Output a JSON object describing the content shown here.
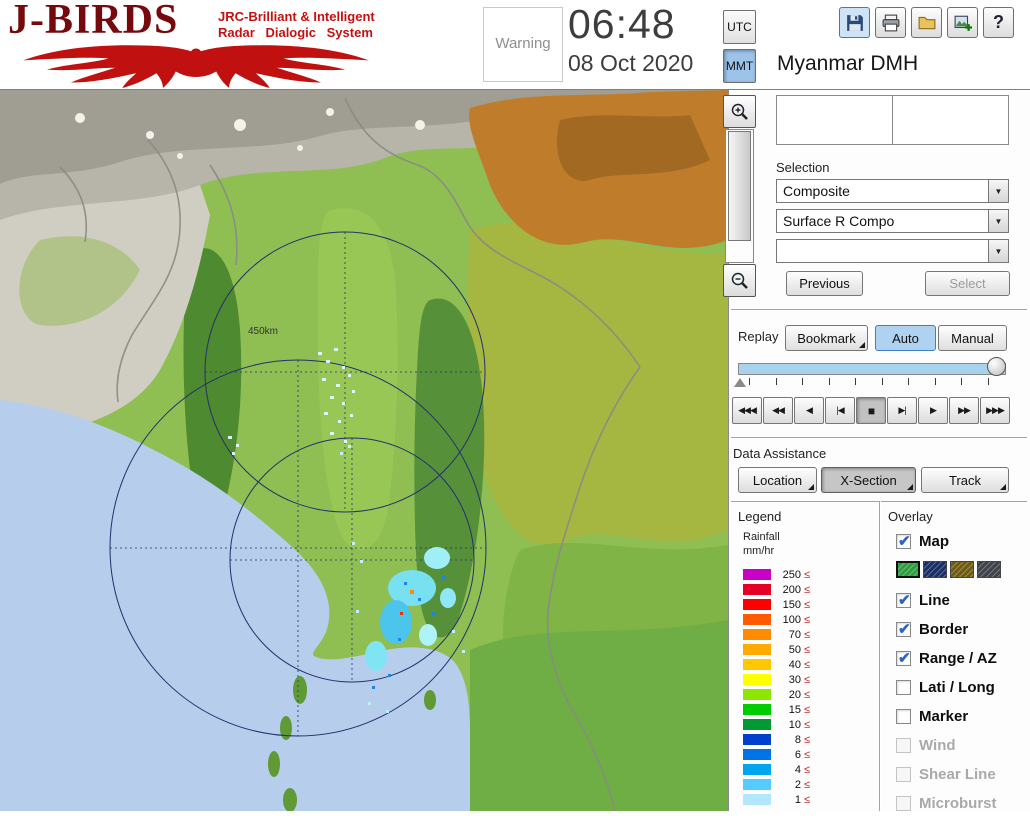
{
  "header": {
    "title": "J-BIRDS",
    "tagline1": "JRC-Brilliant & Intelligent",
    "tagline2": "Radar Dialogic System",
    "warning": "Warning",
    "time": "06:48",
    "date": "08 Oct 2020",
    "utc": "UTC",
    "mmt": "MMT",
    "help": "?",
    "station": "Myanmar DMH"
  },
  "selection": {
    "label": "Selection",
    "combo1": "Composite",
    "combo2": "Surface R Compo",
    "combo3": "",
    "previous": "Previous",
    "select": "Select"
  },
  "replay": {
    "label": "Replay",
    "bookmark": "Bookmark",
    "auto": "Auto",
    "manual": "Manual",
    "playback": [
      "◀◀◀",
      "◀◀",
      "◀",
      "|◀",
      "■",
      "▶|",
      "▶",
      "▶▶",
      "▶▶▶"
    ]
  },
  "assistance": {
    "label": "Data Assistance",
    "location": "Location",
    "xsection": "X-Section",
    "track": "Track"
  },
  "legend": {
    "title": "Legend",
    "unit1": "Rainfall",
    "unit2": "mm/hr",
    "lte": "≤",
    "rows": [
      {
        "value": "250",
        "color": "#c800c8"
      },
      {
        "value": "200",
        "color": "#e60026"
      },
      {
        "value": "150",
        "color": "#ff0000"
      },
      {
        "value": "100",
        "color": "#ff5a00"
      },
      {
        "value": "70",
        "color": "#ff8c00"
      },
      {
        "value": "50",
        "color": "#ffaa00"
      },
      {
        "value": "40",
        "color": "#ffc800"
      },
      {
        "value": "30",
        "color": "#ffff00"
      },
      {
        "value": "20",
        "color": "#8ce600"
      },
      {
        "value": "15",
        "color": "#00cc00"
      },
      {
        "value": "10",
        "color": "#009933"
      },
      {
        "value": "8",
        "color": "#0040cc"
      },
      {
        "value": "6",
        "color": "#0073e6"
      },
      {
        "value": "4",
        "color": "#00a5ee"
      },
      {
        "value": "2",
        "color": "#55ccff"
      },
      {
        "value": "1",
        "color": "#b3e6ff"
      }
    ]
  },
  "overlay": {
    "title": "Overlay",
    "map": {
      "label": "Map",
      "checked": true
    },
    "swatches": [
      {
        "name": "green-map-style",
        "color": "#2f9e41",
        "selected": true
      },
      {
        "name": "navy-map-style",
        "color": "#1b2f66",
        "selected": false
      },
      {
        "name": "olive-map-style",
        "color": "#6e5c12",
        "selected": false
      },
      {
        "name": "gray-map-style",
        "color": "#3f444b",
        "selected": false
      }
    ],
    "items": [
      {
        "label": "Line",
        "checked": true,
        "disabled": false
      },
      {
        "label": "Border",
        "checked": true,
        "disabled": false
      },
      {
        "label": "Range / AZ",
        "checked": true,
        "disabled": false
      },
      {
        "label": "Lati / Long",
        "checked": false,
        "disabled": false
      },
      {
        "label": "Marker",
        "checked": false,
        "disabled": false
      },
      {
        "label": "Wind",
        "checked": false,
        "disabled": true
      },
      {
        "label": "Shear Line",
        "checked": false,
        "disabled": true
      },
      {
        "label": "Microburst",
        "checked": false,
        "disabled": true
      }
    ]
  },
  "map": {
    "range_label": "450km"
  }
}
